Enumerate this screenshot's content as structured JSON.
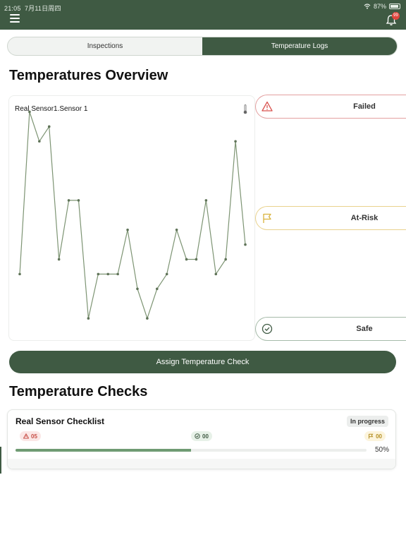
{
  "statusbar": {
    "time": "21:05",
    "date": "7月11日周四",
    "battery": "87%"
  },
  "header": {
    "notification_count": "99"
  },
  "tabs": [
    {
      "label": "Inspections",
      "active": false
    },
    {
      "label": "Temperature Logs",
      "active": true
    }
  ],
  "overview": {
    "title": "Temperatures Overview",
    "chart_label": "Real Sensor1.Sensor 1"
  },
  "chart_data": {
    "type": "line",
    "x": [
      1,
      2,
      3,
      4,
      5,
      6,
      7,
      8,
      9,
      10,
      11,
      12,
      13,
      14,
      15,
      16,
      17,
      18,
      19,
      20,
      21,
      22,
      23,
      24
    ],
    "values": [
      9,
      31,
      27,
      29,
      11,
      19,
      19,
      3,
      9,
      9,
      9,
      15,
      7,
      3,
      7,
      9,
      15,
      11,
      11,
      19,
      9,
      11,
      27,
      13
    ],
    "ylim": [
      1,
      32
    ],
    "line_color": "#7d9473",
    "grid": false
  },
  "status_cards": [
    {
      "id": "failed",
      "label": "Failed",
      "color": "#d9534f"
    },
    {
      "id": "risk",
      "label": "At-Risk",
      "color": "#d9b23c"
    },
    {
      "id": "safe",
      "label": "Safe",
      "color": "#3f5a43"
    }
  ],
  "assign_button": "Assign Temperature Check",
  "checks": {
    "title": "Temperature Checks",
    "items": [
      {
        "name": "Real Sensor Checklist",
        "status": "In progress",
        "failed": "05",
        "safe": "00",
        "risk": "00",
        "progress": 0.5,
        "progress_label": "50%"
      }
    ]
  }
}
